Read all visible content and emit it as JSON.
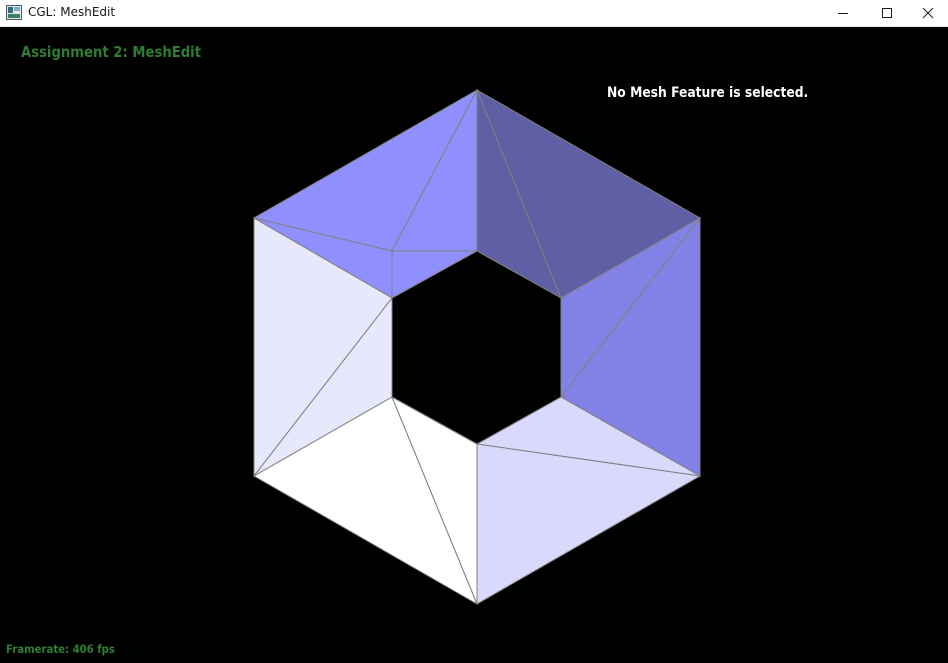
{
  "window": {
    "title": "CGL: MeshEdit",
    "minimize_label": "Minimize",
    "maximize_label": "Maximize",
    "close_label": "Close"
  },
  "viewport": {
    "assignment_title": "Assignment 2: MeshEdit",
    "selection_status": "No Mesh Feature is selected.",
    "framerate": "Framerate: 406 fps"
  },
  "colors": {
    "background": "#000000",
    "overlay_green": "#2e7d32",
    "overlay_white": "#ffffff",
    "edge": "#808080",
    "face_top_left": "#8f90fd",
    "face_top_right": "#5f5fa5",
    "face_right": "#8282e6",
    "face_bottom_right": "#d9d9fd",
    "face_bottom_left": "#ffffff",
    "face_left": "#e8e8fd"
  },
  "mesh": {
    "shape": "hexagonal ring",
    "faces": 6,
    "triangles_per_face": 2
  }
}
